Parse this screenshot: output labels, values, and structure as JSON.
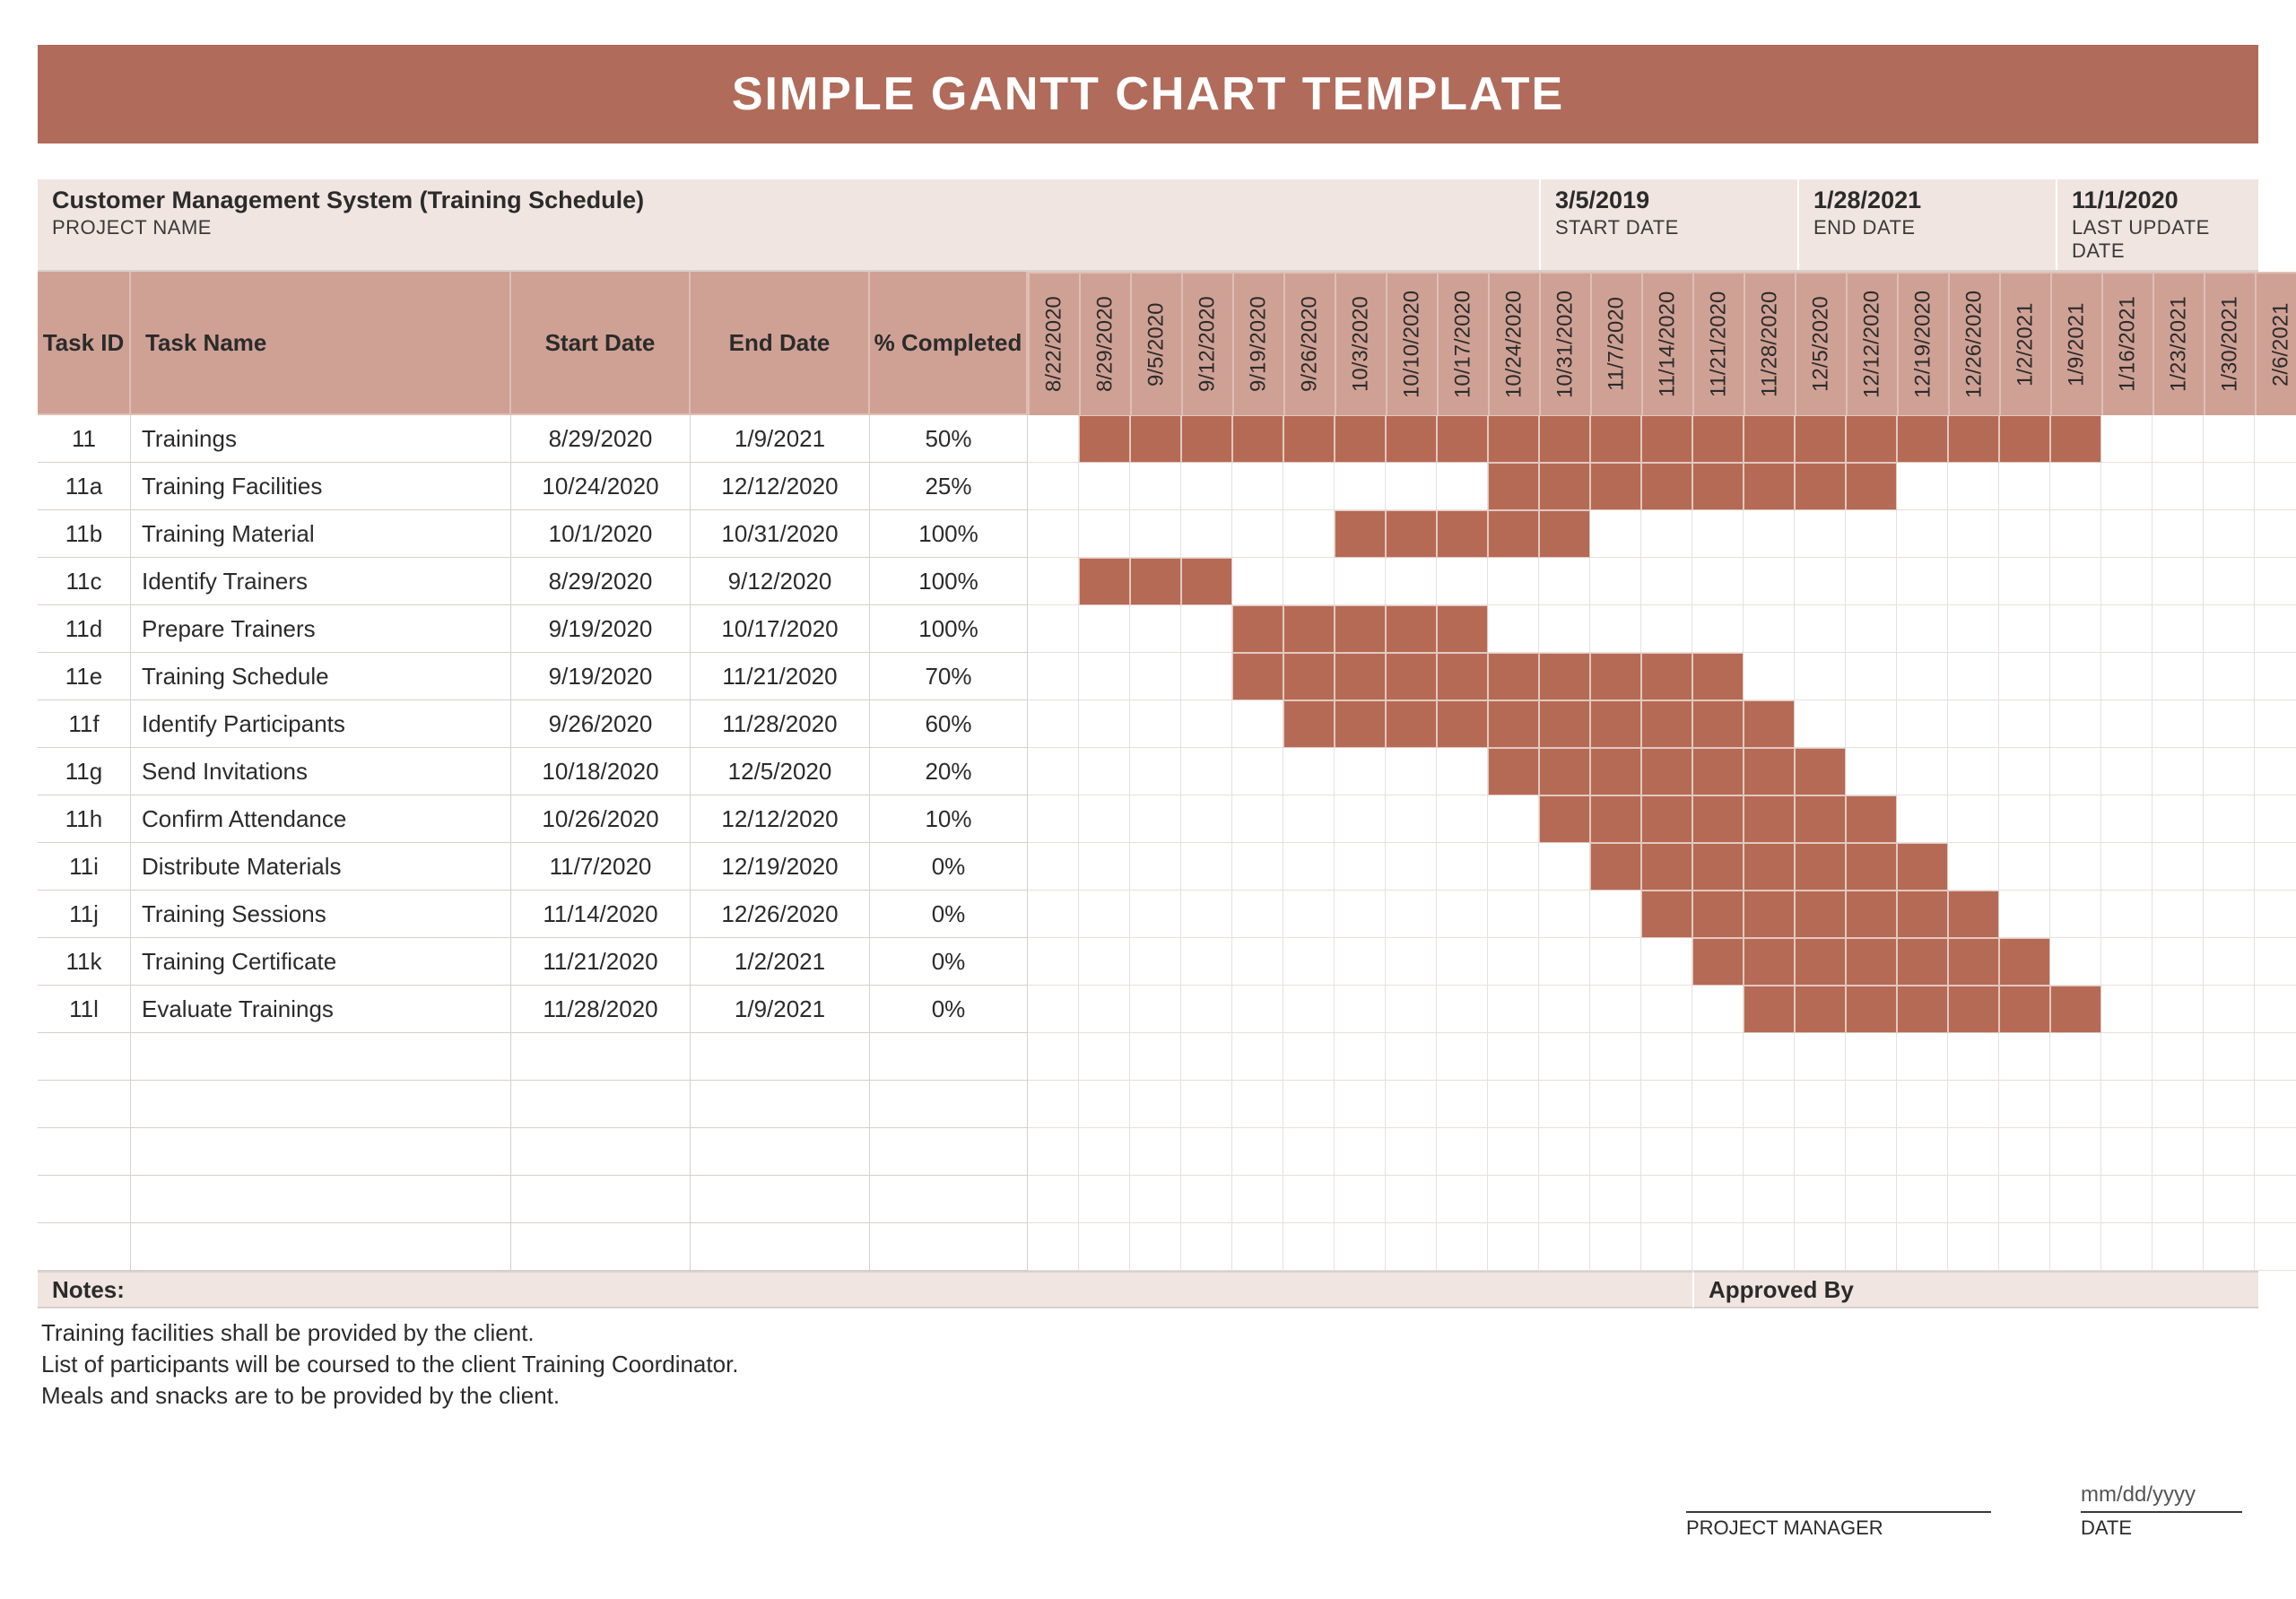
{
  "title": "SIMPLE GANTT CHART TEMPLATE",
  "meta": {
    "project_name_label": "PROJECT NAME",
    "project_name": "Customer Management System (Training Schedule)",
    "start_date_label": "START DATE",
    "start_date": "3/5/2019",
    "end_date_label": "END DATE",
    "end_date": "1/28/2021",
    "last_update_label": "LAST UPDATE DATE",
    "last_update": "11/1/2020"
  },
  "columns": {
    "task_id": "Task ID",
    "task_name": "Task Name",
    "start_date": "Start Date",
    "end_date": "End Date",
    "pct": "% Completed"
  },
  "weeks": [
    "8/22/2020",
    "8/29/2020",
    "9/5/2020",
    "9/12/2020",
    "9/19/2020",
    "9/26/2020",
    "10/3/2020",
    "10/10/2020",
    "10/17/2020",
    "10/24/2020",
    "10/31/2020",
    "11/7/2020",
    "11/14/2020",
    "11/21/2020",
    "11/28/2020",
    "12/5/2020",
    "12/12/2020",
    "12/19/2020",
    "12/26/2020",
    "1/2/2021",
    "1/9/2021",
    "1/16/2021",
    "1/23/2021",
    "1/30/2021",
    "2/6/2021"
  ],
  "tasks": [
    {
      "id": "11",
      "name": "Trainings",
      "start": "8/29/2020",
      "end": "1/9/2021",
      "pct": "50%",
      "span": [
        1,
        20
      ]
    },
    {
      "id": "11a",
      "name": "Training Facilities",
      "start": "10/24/2020",
      "end": "12/12/2020",
      "pct": "25%",
      "span": [
        9,
        16
      ]
    },
    {
      "id": "11b",
      "name": "Training Material",
      "start": "10/1/2020",
      "end": "10/31/2020",
      "pct": "100%",
      "span": [
        6,
        10
      ]
    },
    {
      "id": "11c",
      "name": "Identify Trainers",
      "start": "8/29/2020",
      "end": "9/12/2020",
      "pct": "100%",
      "span": [
        1,
        3
      ]
    },
    {
      "id": "11d",
      "name": "Prepare Trainers",
      "start": "9/19/2020",
      "end": "10/17/2020",
      "pct": "100%",
      "span": [
        4,
        8
      ]
    },
    {
      "id": "11e",
      "name": "Training Schedule",
      "start": "9/19/2020",
      "end": "11/21/2020",
      "pct": "70%",
      "span": [
        4,
        13
      ]
    },
    {
      "id": "11f",
      "name": "Identify Participants",
      "start": "9/26/2020",
      "end": "11/28/2020",
      "pct": "60%",
      "span": [
        5,
        14
      ]
    },
    {
      "id": "11g",
      "name": "Send Invitations",
      "start": "10/18/2020",
      "end": "12/5/2020",
      "pct": "20%",
      "span": [
        9,
        15
      ]
    },
    {
      "id": "11h",
      "name": "Confirm Attendance",
      "start": "10/26/2020",
      "end": "12/12/2020",
      "pct": "10%",
      "span": [
        10,
        16
      ]
    },
    {
      "id": "11i",
      "name": "Distribute Materials",
      "start": "11/7/2020",
      "end": "12/19/2020",
      "pct": "0%",
      "span": [
        11,
        17
      ]
    },
    {
      "id": "11j",
      "name": "Training Sessions",
      "start": "11/14/2020",
      "end": "12/26/2020",
      "pct": "0%",
      "span": [
        12,
        18
      ]
    },
    {
      "id": "11k",
      "name": "Training Certificate",
      "start": "11/21/2020",
      "end": "1/2/2021",
      "pct": "0%",
      "span": [
        13,
        19
      ]
    },
    {
      "id": "11l",
      "name": "Evaluate Trainings",
      "start": "11/28/2020",
      "end": "1/9/2021",
      "pct": "0%",
      "span": [
        14,
        20
      ]
    }
  ],
  "empty_rows": 5,
  "footer": {
    "notes_label": "Notes:",
    "approved_label": "Approved By",
    "notes": [
      "Training facilities shall be provided by the client.",
      "List of participants will be coursed to the client Training Coordinator.",
      "Meals and snacks are to be provided by the client."
    ],
    "sign_pm": "PROJECT MANAGER",
    "sign_date_label": "DATE",
    "sign_date_placeholder": "mm/dd/yyyy"
  },
  "chart_data": {
    "type": "gantt",
    "title": "SIMPLE GANTT CHART TEMPLATE",
    "x_categories": [
      "8/22/2020",
      "8/29/2020",
      "9/5/2020",
      "9/12/2020",
      "9/19/2020",
      "9/26/2020",
      "10/3/2020",
      "10/10/2020",
      "10/17/2020",
      "10/24/2020",
      "10/31/2020",
      "11/7/2020",
      "11/14/2020",
      "11/21/2020",
      "11/28/2020",
      "12/5/2020",
      "12/12/2020",
      "12/19/2020",
      "12/26/2020",
      "1/2/2021",
      "1/9/2021",
      "1/16/2021",
      "1/23/2021",
      "1/30/2021",
      "2/6/2021"
    ],
    "tasks": [
      {
        "id": "11",
        "name": "Trainings",
        "start": "8/29/2020",
        "end": "1/9/2021",
        "pct_completed": 50
      },
      {
        "id": "11a",
        "name": "Training Facilities",
        "start": "10/24/2020",
        "end": "12/12/2020",
        "pct_completed": 25
      },
      {
        "id": "11b",
        "name": "Training Material",
        "start": "10/1/2020",
        "end": "10/31/2020",
        "pct_completed": 100
      },
      {
        "id": "11c",
        "name": "Identify Trainers",
        "start": "8/29/2020",
        "end": "9/12/2020",
        "pct_completed": 100
      },
      {
        "id": "11d",
        "name": "Prepare Trainers",
        "start": "9/19/2020",
        "end": "10/17/2020",
        "pct_completed": 100
      },
      {
        "id": "11e",
        "name": "Training Schedule",
        "start": "9/19/2020",
        "end": "11/21/2020",
        "pct_completed": 70
      },
      {
        "id": "11f",
        "name": "Identify Participants",
        "start": "9/26/2020",
        "end": "11/28/2020",
        "pct_completed": 60
      },
      {
        "id": "11g",
        "name": "Send Invitations",
        "start": "10/18/2020",
        "end": "12/5/2020",
        "pct_completed": 20
      },
      {
        "id": "11h",
        "name": "Confirm Attendance",
        "start": "10/26/2020",
        "end": "12/12/2020",
        "pct_completed": 10
      },
      {
        "id": "11i",
        "name": "Distribute Materials",
        "start": "11/7/2020",
        "end": "12/19/2020",
        "pct_completed": 0
      },
      {
        "id": "11j",
        "name": "Training Sessions",
        "start": "11/14/2020",
        "end": "12/26/2020",
        "pct_completed": 0
      },
      {
        "id": "11k",
        "name": "Training Certificate",
        "start": "11/21/2020",
        "end": "1/2/2021",
        "pct_completed": 0
      },
      {
        "id": "11l",
        "name": "Evaluate Trainings",
        "start": "11/28/2020",
        "end": "1/9/2021",
        "pct_completed": 0
      }
    ]
  }
}
